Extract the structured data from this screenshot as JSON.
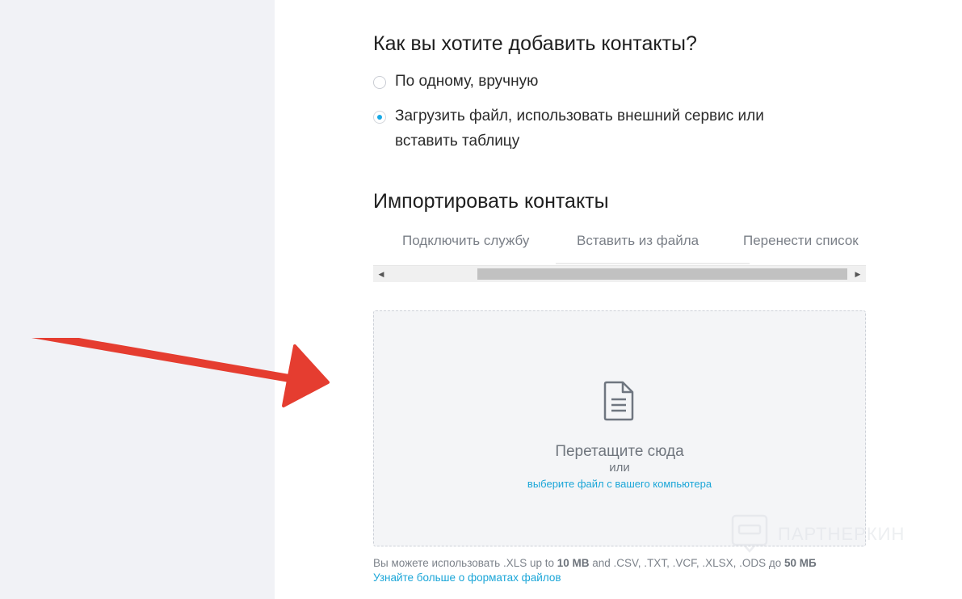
{
  "question": {
    "title": "Как вы хотите добавить контакты?",
    "options": [
      {
        "label": "По одному, вручную",
        "selected": false
      },
      {
        "label": "Загрузить файл, использовать внешний сервис или вставить таблицу",
        "selected": true
      }
    ]
  },
  "import": {
    "title": "Импортировать контакты",
    "tabs": [
      {
        "label": "Подключить службу"
      },
      {
        "label": "Вставить из файла"
      },
      {
        "label": "Перенести список"
      }
    ]
  },
  "dropzone": {
    "icon": "document-icon",
    "title": "Перетащите сюда",
    "or": "или",
    "link": "выберите файл с вашего компьютера"
  },
  "hint": {
    "prefix": "Вы можете использовать .XLS up to ",
    "size1": "10 MB",
    "middle": " and .CSV, .TXT, .VCF, .XLSX, .ODS до ",
    "size2": "50 МБ",
    "link": "Узнайте больше о форматах файлов"
  },
  "watermark": {
    "text": "ПАРТНЕРКИН",
    "icon": "partnerkin-logo-icon"
  },
  "colors": {
    "accent": "#17a9e6",
    "link": "#1ba6d8",
    "sidebar_bg": "#f1f2f6",
    "annotation_arrow": "#e53d30"
  }
}
